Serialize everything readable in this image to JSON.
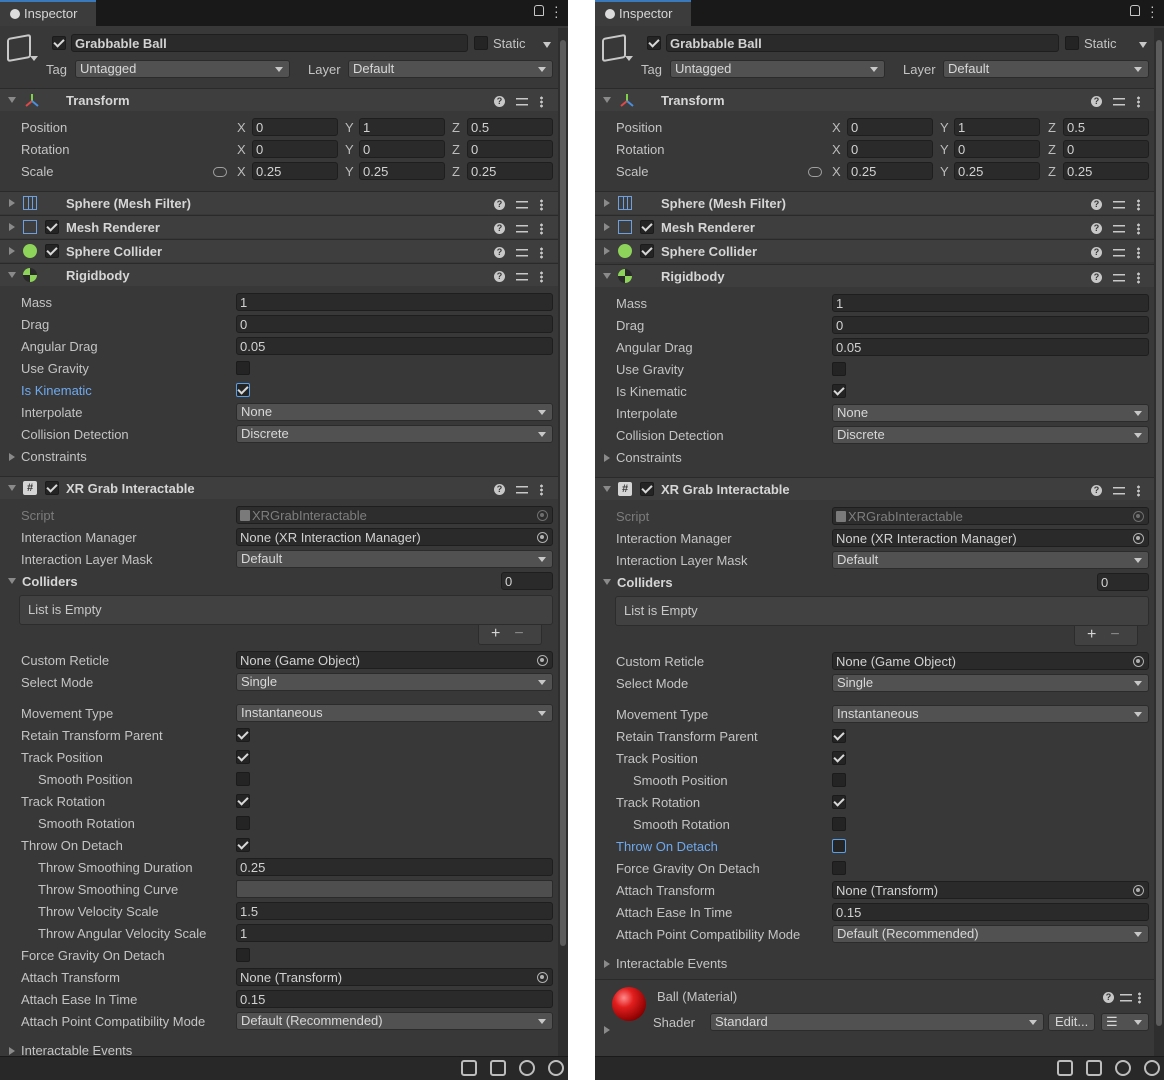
{
  "tab_title": "Inspector",
  "gameobject": {
    "name": "Grabbable Ball",
    "static_label": "Static",
    "tag_label": "Tag",
    "tag_value": "Untagged",
    "layer_label": "Layer",
    "layer_value": "Default"
  },
  "transform": {
    "title": "Transform",
    "position_label": "Position",
    "rotation_label": "Rotation",
    "scale_label": "Scale",
    "position": {
      "x": "0",
      "y": "1",
      "z": "0.5"
    },
    "rotation": {
      "x": "0",
      "y": "0",
      "z": "0"
    },
    "scale": {
      "x": "0.25",
      "y": "0.25",
      "z": "0.25"
    },
    "axis_x": "X",
    "axis_y": "Y",
    "axis_z": "Z"
  },
  "mesh_filter": {
    "title": "Sphere (Mesh Filter)"
  },
  "mesh_renderer": {
    "title": "Mesh Renderer"
  },
  "sphere_collider": {
    "title": "Sphere Collider"
  },
  "rigidbody": {
    "title": "Rigidbody",
    "mass_label": "Mass",
    "mass": "1",
    "drag_label": "Drag",
    "drag": "0",
    "angular_drag_label": "Angular Drag",
    "angular_drag": "0.05",
    "use_gravity_label": "Use Gravity",
    "is_kinematic_label": "Is Kinematic",
    "interpolate_label": "Interpolate",
    "interpolate": "None",
    "collision_label": "Collision Detection",
    "collision": "Discrete",
    "constraints_label": "Constraints"
  },
  "xr": {
    "title": "XR Grab Interactable",
    "script_label": "Script",
    "script": "XRGrabInteractable",
    "manager_label": "Interaction Manager",
    "manager": "None (XR Interaction Manager)",
    "layer_mask_label": "Interaction Layer Mask",
    "layer_mask": "Default",
    "colliders_label": "Colliders",
    "colliders_count": "0",
    "list_empty": "List is Empty",
    "plus": "+",
    "minus": "−",
    "reticle_label": "Custom Reticle",
    "reticle": "None (Game Object)",
    "select_mode_label": "Select Mode",
    "select_mode": "Single",
    "movement_label": "Movement Type",
    "movement": "Instantaneous",
    "retain_label": "Retain Transform Parent",
    "track_pos_label": "Track Position",
    "smooth_pos_label": "Smooth Position",
    "track_rot_label": "Track Rotation",
    "smooth_rot_label": "Smooth Rotation",
    "throw_label": "Throw On Detach",
    "throw_dur_label": "Throw Smoothing Duration",
    "throw_dur": "0.25",
    "throw_curve_label": "Throw Smoothing Curve",
    "throw_vel_label": "Throw Velocity Scale",
    "throw_vel": "1.5",
    "throw_ang_label": "Throw Angular Velocity Scale",
    "throw_ang": "1",
    "force_grav_label": "Force Gravity On Detach",
    "attach_label": "Attach Transform",
    "attach": "None (Transform)",
    "ease_label": "Attach Ease In Time",
    "ease": "0.15",
    "compat_label": "Attach Point Compatibility Mode",
    "compat": "Default (Recommended)",
    "events_label": "Interactable Events"
  },
  "material": {
    "name": "Ball (Material)",
    "shader_label": "Shader",
    "shader": "Standard",
    "edit": "Edit..."
  },
  "colors": {
    "panel_bg": "#383838",
    "tab_accent": "#3a79bb",
    "highlight_label": "#6ea9ee"
  }
}
